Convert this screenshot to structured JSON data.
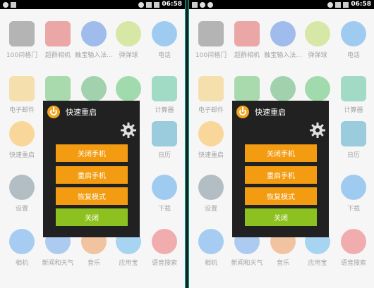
{
  "status_bar": {
    "time": "06:58"
  },
  "apps": [
    {
      "label": "100间格门",
      "color": "#5a5a5a",
      "shape": "sq",
      "col": 0,
      "row": 0
    },
    {
      "label": "超群相机",
      "color": "#d23a3a",
      "shape": "sq",
      "col": 1,
      "row": 0
    },
    {
      "label": "触宝输入法...",
      "color": "#2b6bd8",
      "shape": "round",
      "col": 2,
      "row": 0
    },
    {
      "label": "弹弹球",
      "color": "#a7c93a",
      "shape": "round",
      "col": 3,
      "row": 0
    },
    {
      "label": "电话",
      "color": "#2d8de0",
      "shape": "round",
      "col": 4,
      "row": 0
    },
    {
      "label": "电子邮件",
      "color": "#e8b84b",
      "shape": "sq",
      "col": 0,
      "row": 1
    },
    {
      "label": "",
      "color": "#3fae49",
      "shape": "sq",
      "col": 1,
      "row": 1
    },
    {
      "label": "",
      "color": "#2f9a49",
      "shape": "round",
      "col": 2,
      "row": 1
    },
    {
      "label": "",
      "color": "#2fae49",
      "shape": "round",
      "col": 3,
      "row": 1
    },
    {
      "label": "计算器",
      "color": "#2fae7f",
      "shape": "sq",
      "col": 4,
      "row": 1
    },
    {
      "label": "快速重启",
      "color": "#f2a623",
      "shape": "round",
      "col": 0,
      "row": 2
    },
    {
      "label": "日历",
      "color": "#1f8fb5",
      "shape": "sq",
      "col": 4,
      "row": 2
    },
    {
      "label": "设置",
      "color": "#58707d",
      "shape": "round",
      "col": 0,
      "row": 3
    },
    {
      "label": "下载",
      "color": "#2d8de0",
      "shape": "round",
      "col": 4,
      "row": 3
    },
    {
      "label": "相机",
      "color": "#3a8fe0",
      "shape": "round",
      "col": 0,
      "row": 4
    },
    {
      "label": "新闻和天气",
      "color": "#4a8de0",
      "shape": "round",
      "col": 1,
      "row": 4
    },
    {
      "label": "音乐",
      "color": "#e07a2d",
      "shape": "round",
      "col": 2,
      "row": 4
    },
    {
      "label": "应用宝",
      "color": "#3aa0e0",
      "shape": "round",
      "col": 3,
      "row": 4
    },
    {
      "label": "语音搜索",
      "color": "#e04a4a",
      "shape": "round",
      "col": 4,
      "row": 4
    }
  ],
  "dialog": {
    "title": "快速重启",
    "shutdown_label": "关闭手机",
    "reboot_label": "重启手机",
    "recovery_label": "恢复模式",
    "close_label": "关闭"
  },
  "colors": {
    "orange": "#f39c12",
    "green": "#8dc11f",
    "dialog_bg": "#212121",
    "accent": "#0f7a6c"
  }
}
